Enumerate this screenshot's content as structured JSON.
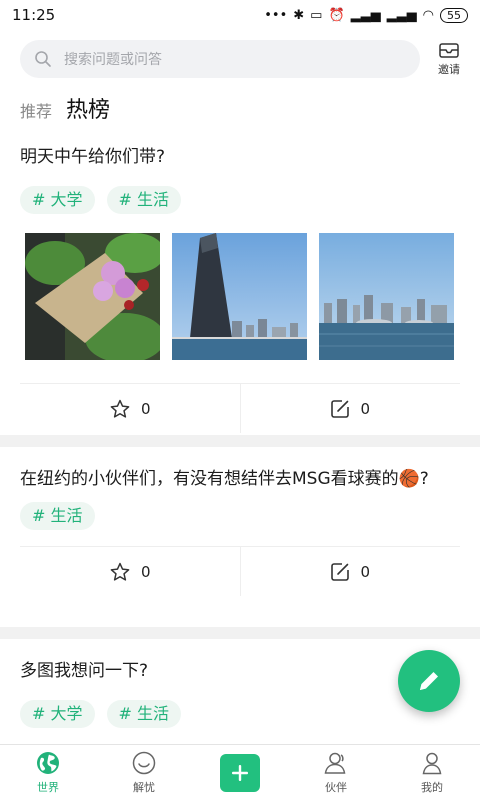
{
  "status": {
    "time": "11:25",
    "battery": "55"
  },
  "search": {
    "placeholder": "搜索问题或问答"
  },
  "invite": {
    "label": "邀请"
  },
  "tabs": {
    "recommend": "推荐",
    "hot": "热榜"
  },
  "posts": [
    {
      "title": "明天中午给你们带?",
      "tags": [
        "# 大学",
        "# 生活"
      ],
      "likes": "0",
      "comments": "0"
    },
    {
      "title": "在纽约的小伙伴们，有没有想结伴去MSG看球赛的🏀?",
      "tags": [
        "# 生活"
      ],
      "likes": "0",
      "comments": "0"
    },
    {
      "title": "多图我想问一下?",
      "tags": [
        "# 大学",
        "# 生活"
      ]
    }
  ],
  "nav": [
    {
      "label": "世界",
      "icon": "globe-icon"
    },
    {
      "label": "解忧",
      "icon": "smile-icon"
    },
    {
      "label": "",
      "icon": "add-icon"
    },
    {
      "label": "伙伴",
      "icon": "people-icon"
    },
    {
      "label": "我的",
      "icon": "user-icon"
    }
  ],
  "colors": {
    "accent": "#22c07f",
    "tag_text": "#21b27a",
    "tag_bg": "#eef6f2"
  }
}
